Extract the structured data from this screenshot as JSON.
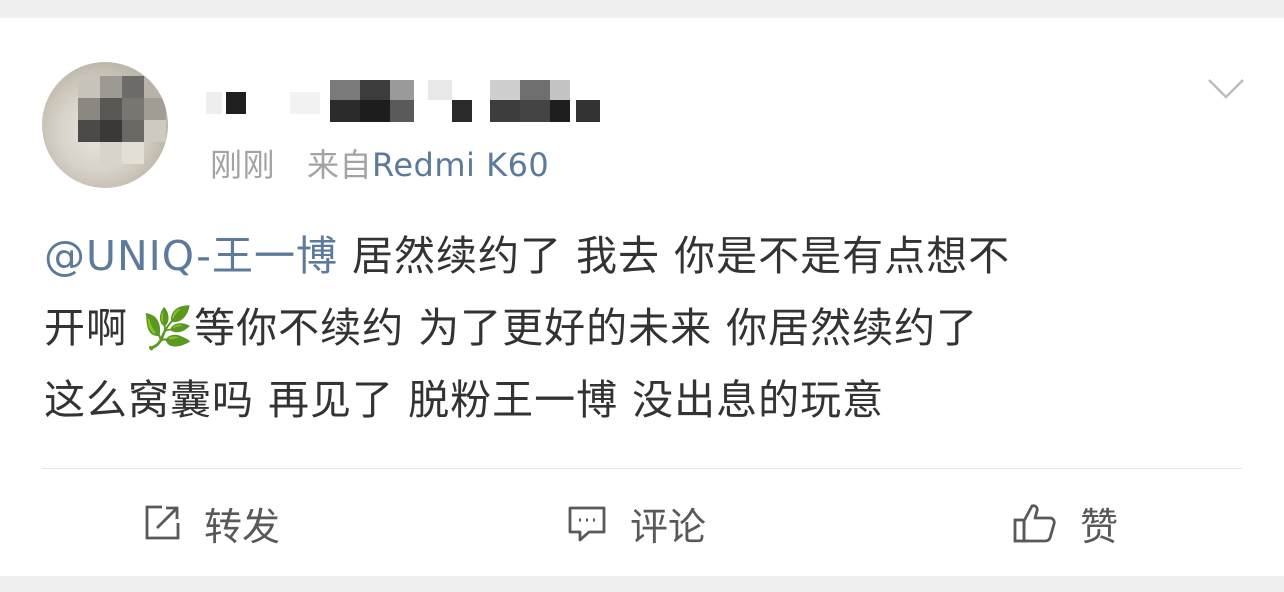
{
  "post": {
    "timestamp": "刚刚",
    "source_prefix": "来自",
    "source_device": "Redmi K60",
    "mention": "@UNIQ-王一博",
    "content_lines": [
      " 居然续约了  我去 你是不是有点想不",
      "开啊  🌿等你不续约 为了更好的未来  你居然续约了",
      "这么窝囊吗  再见了 脱粉王一博  没出息的玩意"
    ]
  },
  "actions": {
    "repost_label": "转发",
    "comment_label": "评论",
    "like_label": "赞"
  },
  "icons": {
    "more": "chevron-down-icon",
    "repost": "repost-icon",
    "comment": "comment-icon",
    "like": "thumbs-up-icon",
    "emoji": "herb-emoji"
  },
  "colors": {
    "link": "#5b7a9c",
    "text": "#333333",
    "meta": "#a3a3a3",
    "background": "#f0f0f0"
  }
}
